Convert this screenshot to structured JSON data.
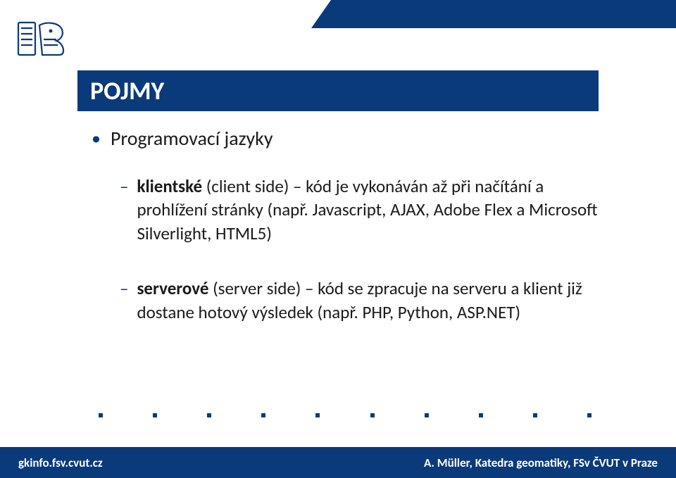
{
  "title": "POJMY",
  "bullet_main": "Programovací jazyky",
  "items": [
    {
      "lead_bold": "klientské",
      "lead_plain": " (client side) – kód je vykonáván až při načítání a prohlížení stránky (např. Javascript, AJAX, Adobe Flex a Microsoft Silverlight, HTML5)"
    },
    {
      "lead_bold": "serverové",
      "lead_plain": " (server side) – kód se zpracuje na serveru a klient již dostane hotový výsledek (např. PHP, Python, ASP.NET)"
    }
  ],
  "footer_left": "gkinfo.fsv.cvut.cz",
  "footer_right": "A. Müller, Katedra geomatiky, FSv ČVUT v Praze"
}
